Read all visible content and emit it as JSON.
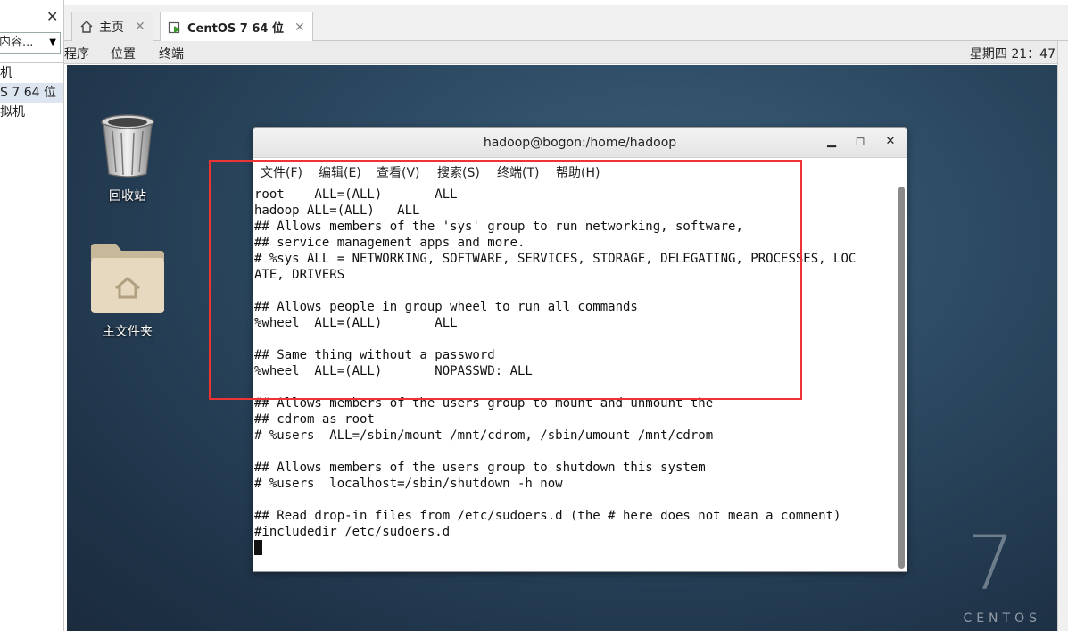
{
  "library_panel": {
    "search_placeholder": "内容...",
    "items": [
      "机",
      "S 7 64 位",
      "拟机"
    ],
    "selected_index": 1
  },
  "tabs": [
    {
      "label": "主页",
      "icon": "home-icon"
    },
    {
      "label": "CentOS 7 64 位",
      "icon": "vm-running-icon"
    }
  ],
  "vm_menu": {
    "items": [
      "程序",
      "位置",
      "终端"
    ],
    "clock": "星期四 21：47"
  },
  "desktop": {
    "icons": [
      {
        "label": "回收站",
        "icon": "trash-icon"
      },
      {
        "label": "主文件夹",
        "icon": "home-folder-icon"
      }
    ],
    "brand_number": "7",
    "brand_word": "CENTOS"
  },
  "terminal": {
    "title": "hadoop@bogon:/home/hadoop",
    "menu": [
      "文件(F)",
      "编辑(E)",
      "查看(V)",
      "搜索(S)",
      "终端(T)",
      "帮助(H)"
    ],
    "lines": [
      "root    ALL=(ALL)       ALL",
      "hadoop ALL=(ALL)   ALL",
      "## Allows members of the 'sys' group to run networking, software,",
      "## service management apps and more.",
      "# %sys ALL = NETWORKING, SOFTWARE, SERVICES, STORAGE, DELEGATING, PROCESSES, LOC",
      "ATE, DRIVERS",
      "",
      "## Allows people in group wheel to run all commands",
      "%wheel  ALL=(ALL)       ALL",
      "",
      "## Same thing without a password",
      "%wheel  ALL=(ALL)       NOPASSWD: ALL",
      "",
      "## Allows members of the users group to mount and unmount the",
      "## cdrom as root",
      "# %users  ALL=/sbin/mount /mnt/cdrom, /sbin/umount /mnt/cdrom",
      "",
      "## Allows members of the users group to shutdown this system",
      "# %users  localhost=/sbin/shutdown -h now",
      "",
      "## Read drop-in files from /etc/sudoers.d (the # here does not mean a comment)",
      "#includedir /etc/sudoers.d"
    ]
  },
  "colors": {
    "highlight_box": "#e33333",
    "desktop_bg": "#2a475f"
  }
}
